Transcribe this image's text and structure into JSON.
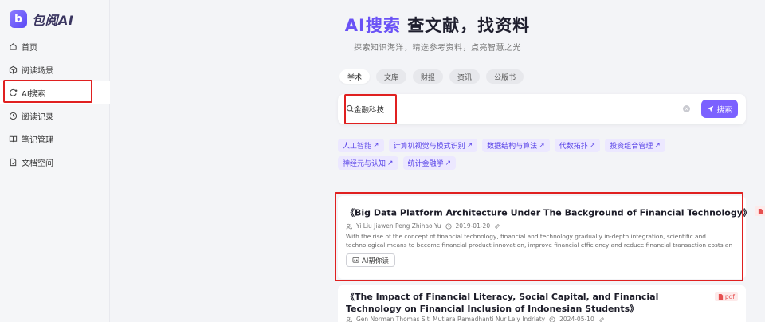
{
  "app": {
    "logo_letter": "b",
    "name": "包阅AI"
  },
  "sidebar": {
    "items": [
      {
        "label": "首页",
        "icon": "home-icon"
      },
      {
        "label": "阅读场景",
        "icon": "cube-icon"
      },
      {
        "label": "AI搜索",
        "icon": "ai-search-icon",
        "active": true
      },
      {
        "label": "阅读记录",
        "icon": "clock-icon"
      },
      {
        "label": "笔记管理",
        "icon": "book-icon"
      },
      {
        "label": "文档空间",
        "icon": "folder-icon"
      }
    ]
  },
  "hero": {
    "title_accent": "AI搜索",
    "title_rest": "查文献，找资料",
    "subtitle": "探索知识海洋，精选参考资料，点亮智慧之光"
  },
  "tabs": [
    {
      "label": "学术",
      "active": true
    },
    {
      "label": "文库"
    },
    {
      "label": "财报"
    },
    {
      "label": "资讯"
    },
    {
      "label": "公版书"
    }
  ],
  "search": {
    "value": "金融科技",
    "button_label": "搜索"
  },
  "suggestions": [
    "人工智能",
    "计算机视觉与模式识别",
    "数据结构与算法",
    "代数拓扑",
    "投资组合管理",
    "神经元与认知",
    "统计金融学"
  ],
  "results": [
    {
      "title": "《Big Data Platform Architecture Under The Background of Financial Technology》",
      "badge": "pdf",
      "authors": "Yi Liu   Jiawen Peng   Zhihao Yu",
      "date": "2019-01-20",
      "abstract": "With the rise of the concept of financial technology, financial and technology gradually in-depth integration, scientific and technological means to become financial product innovation, improve financial efficiency and reduce financial transaction costs an important driving…",
      "ai_label": "AI帮你读"
    },
    {
      "title": "《The Impact of Financial Literacy, Social Capital, and Financial Technology on Financial Inclusion of Indonesian Students》",
      "badge": "pdf",
      "authors": "Gen Norman Thomas   Siti Mutiara Ramadhanti Nur   Lely Indriaty",
      "date": "2024-05-10"
    }
  ],
  "colors": {
    "accent": "#6a52f6",
    "button": "#7b61ff",
    "highlight": "#e02020",
    "chip_bg": "#ece8ff",
    "pdf": "#e65050"
  }
}
